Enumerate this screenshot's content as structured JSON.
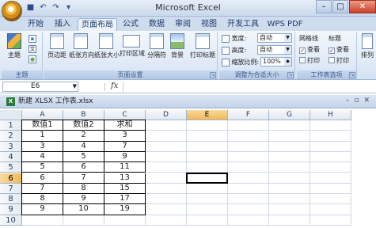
{
  "app": {
    "title": "Microsoft Excel"
  },
  "qat": {
    "save_icon": "save-icon",
    "undo_icon": "undo-icon",
    "redo_icon": "redo-icon",
    "undo": "↶",
    "redo": "↷",
    "more": "▾"
  },
  "window_controls": {
    "minimize": "–",
    "maximize": "□",
    "close": "✕"
  },
  "tabs": [
    {
      "label": "开始"
    },
    {
      "label": "插入"
    },
    {
      "label": "页面布局"
    },
    {
      "label": "公式"
    },
    {
      "label": "数据"
    },
    {
      "label": "审阅"
    },
    {
      "label": "视图"
    },
    {
      "label": "开发工具"
    },
    {
      "label": "WPS PDF"
    }
  ],
  "active_tab": "页面布局",
  "ribbon": {
    "theme": {
      "theme_label": "主题",
      "small1": "▪",
      "small2": "文",
      "small3": "●",
      "group": "主题"
    },
    "page_setup": {
      "buttons": [
        "页边距",
        "纸张方向",
        "纸张大小",
        "打印区域",
        "分隔符",
        "背景",
        "打印标题"
      ],
      "group": "页面设置"
    },
    "scale": {
      "width_label": "宽度:",
      "width_value": "自动",
      "height_label": "高度:",
      "height_value": "自动",
      "scale_label": "缩放比例:",
      "scale_value": "100%",
      "group": "调整为合适大小"
    },
    "sheet_options": {
      "gridlines": "网格线",
      "headings": "标题",
      "view": "查看",
      "print": "打印",
      "group": "工作表选项"
    },
    "arrange": {
      "label": "排列"
    }
  },
  "formula_bar": {
    "name_box": "E6",
    "fx": "fx",
    "formula": ""
  },
  "workbook": {
    "title": "新建 XLSX 工作表.xlsx",
    "min": "–",
    "restore": "▫",
    "close": "✕"
  },
  "grid": {
    "columns": [
      "A",
      "B",
      "C",
      "D",
      "E",
      "F",
      "G",
      "H"
    ],
    "rows": [
      {
        "n": "1",
        "cells": [
          "数值1",
          "数值2",
          "求和"
        ]
      },
      {
        "n": "2",
        "cells": [
          "1",
          "2",
          "3"
        ]
      },
      {
        "n": "3",
        "cells": [
          "3",
          "4",
          "7"
        ]
      },
      {
        "n": "4",
        "cells": [
          "4",
          "5",
          "9"
        ]
      },
      {
        "n": "5",
        "cells": [
          "5",
          "6",
          "11"
        ]
      },
      {
        "n": "6",
        "cells": [
          "6",
          "7",
          "13"
        ]
      },
      {
        "n": "7",
        "cells": [
          "7",
          "8",
          "15"
        ]
      },
      {
        "n": "8",
        "cells": [
          "8",
          "9",
          "17"
        ]
      },
      {
        "n": "9",
        "cells": [
          "9",
          "10",
          "19"
        ]
      },
      {
        "n": "10",
        "cells": [
          "",
          "",
          ""
        ]
      }
    ],
    "selected_cell": "E6"
  }
}
